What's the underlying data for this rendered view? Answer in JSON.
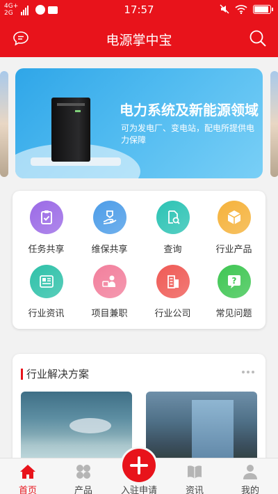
{
  "status_bar": {
    "network_top": "4G+",
    "network_bottom": "2G",
    "time": "17:57",
    "battery_level": 0.95
  },
  "header": {
    "title": "电源掌中宝",
    "left_icon": "message-icon",
    "right_icon": "search-icon"
  },
  "banner": {
    "title": "电力系统及新能源领域",
    "subtitle": "可为发电厂、变电站，配电所提供电力保障"
  },
  "grid": {
    "items": [
      {
        "label": "任务共享",
        "icon": "clipboard-check-icon",
        "color": "#9b6ae6"
      },
      {
        "label": "维保共享",
        "icon": "maintenance-hand-icon",
        "color": "#4d9de8"
      },
      {
        "label": "查询",
        "icon": "document-search-icon",
        "color": "#2cc3b4"
      },
      {
        "label": "行业产品",
        "icon": "cube-icon",
        "color": "#f5b23b"
      },
      {
        "label": "行业资讯",
        "icon": "news-icon",
        "color": "#2fc1a9"
      },
      {
        "label": "项目兼职",
        "icon": "worker-icon",
        "color": "#f27f9c"
      },
      {
        "label": "行业公司",
        "icon": "building-icon",
        "color": "#ef5a55"
      },
      {
        "label": "常见问题",
        "icon": "question-icon",
        "color": "#3fc653"
      }
    ]
  },
  "solutions": {
    "title": "行业解决方案"
  },
  "tabbar": {
    "tabs": [
      {
        "label": "首页",
        "icon": "home-icon",
        "active": true
      },
      {
        "label": "产品",
        "icon": "grid-icon",
        "active": false
      },
      {
        "label": "入驻申请",
        "icon": "plus-icon",
        "active": false
      },
      {
        "label": "资讯",
        "icon": "book-icon",
        "active": false
      },
      {
        "label": "我的",
        "icon": "user-icon",
        "active": false
      }
    ]
  },
  "colors": {
    "brand_red": "#e8131b"
  }
}
